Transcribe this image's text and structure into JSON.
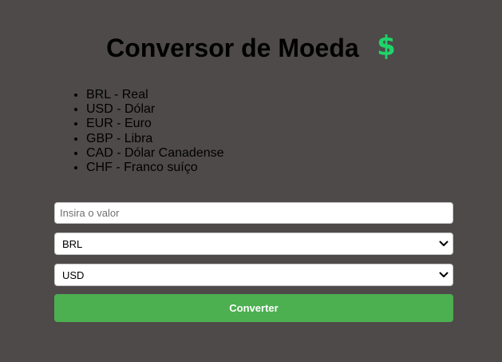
{
  "header": {
    "title": "Conversor de Moeda",
    "icon": "dollar-sign-icon",
    "icon_glyph": "$",
    "icon_color": "#1fd36a"
  },
  "currencies": [
    "BRL - Real",
    "USD - Dólar",
    "EUR - Euro",
    "GBP - Libra",
    "CAD - Dólar Canadense",
    "CHF - Franco suíço"
  ],
  "form": {
    "amount_placeholder": "Insira o valor",
    "amount_value": "",
    "from_currency": "BRL",
    "to_currency": "USD",
    "convert_label": "Converter"
  },
  "colors": {
    "background": "#4e4a49",
    "button": "#4caf50",
    "button_text": "#ffffff"
  }
}
